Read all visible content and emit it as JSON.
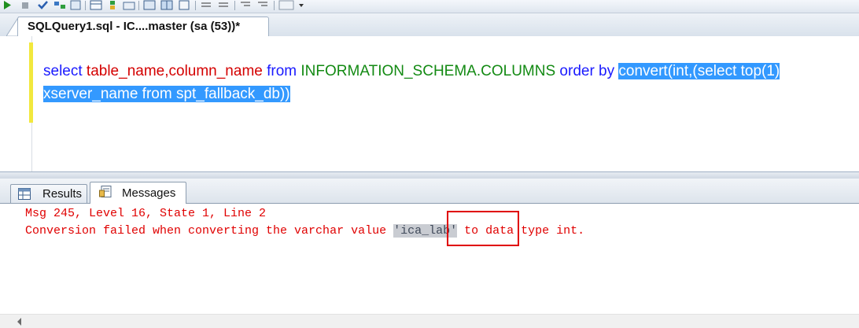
{
  "toolbar": {
    "icons": [
      "execute-icon",
      "stop-icon",
      "parse-icon",
      "display-plan-icon",
      "query-options-icon",
      "results-to-grid-icon",
      "include-plan-icon",
      "sqlcmd-icon",
      "results-text-icon",
      "results-grid-icon",
      "results-file-icon",
      "comment-icon",
      "uncomment-icon",
      "decrease-indent-icon",
      "increase-indent-icon",
      "specify-values-icon"
    ]
  },
  "document_tab": {
    "label": "SQLQuery1.sql - IC....master (sa (53))*"
  },
  "editor": {
    "line1": {
      "t1": "select ",
      "t2": "table_name,column_name",
      "t3": " from ",
      "t4": "INFORMATION_SCHEMA.COLUMNS",
      "t5": " order by ",
      "t6": "convert(int,(select top(1)"
    },
    "line2": {
      "t1": "xserver_name from spt_fallback_db))"
    }
  },
  "results_tabs": {
    "results_label": "Results",
    "messages_label": "Messages"
  },
  "messages": {
    "line1": "Msg 245, Level 16, State 1, Line 2",
    "line2_before": "Conversion failed when converting the varchar value ",
    "line2_value": "'ica_lab'",
    "line2_after": " to data type int."
  },
  "colors": {
    "error_red": "#e00000",
    "keyword_blue": "#1a1aff",
    "identifier_red": "#d40000",
    "schema_green": "#138a13",
    "selection_blue": "#3399ff"
  }
}
